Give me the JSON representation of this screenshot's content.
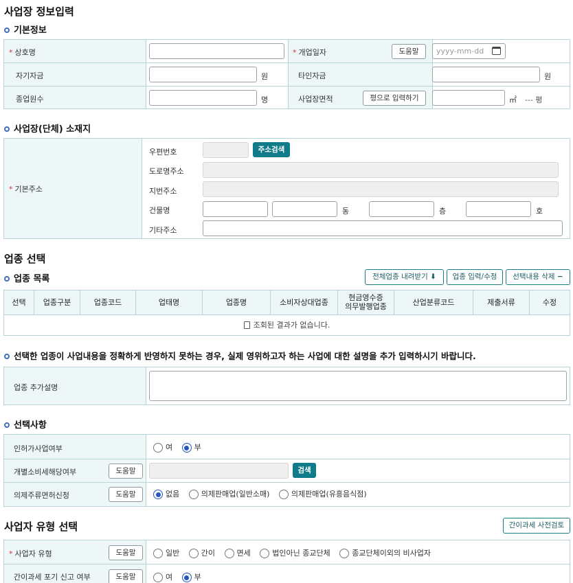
{
  "page_title": "사업장 정보입력",
  "basic": {
    "title": "기본정보",
    "trade_name_label": "상호명",
    "open_date_label": "개업일자",
    "help_label": "도움말",
    "date_placeholder": "yyyy-mm-dd",
    "own_capital_label": "자기자금",
    "won_unit": "원",
    "other_capital_label": "타인자금",
    "employees_label": "종업원수",
    "person_unit": "명",
    "area_label": "사업장면적",
    "pyeong_input_button": "평으로 입력하기",
    "sqm_unit": "㎡",
    "pyeong_readout": "--- 평"
  },
  "location": {
    "title": "사업장(단체) 소재지",
    "base_address_label": "기본주소",
    "zipcode_label": "우편번호",
    "address_search_button": "주소검색",
    "road_address_label": "도로명주소",
    "lot_address_label": "지번주소",
    "building_label": "건물명",
    "dong_unit": "동",
    "floor_unit": "층",
    "ho_unit": "호",
    "other_address_label": "기타주소"
  },
  "industry": {
    "title": "업종 선택",
    "list_title": "업종 목록",
    "download_button": "전체업종 내려받기",
    "edit_button": "업종 입력/수정",
    "delete_button": "선택내용 삭제",
    "columns": [
      "선택",
      "업종구분",
      "업종코드",
      "업태명",
      "업종명",
      "소비자상대업종",
      "현금영수증\n의무발행업종",
      "산업분류코드",
      "제출서류",
      "수정"
    ],
    "empty_message": "조회된 결과가 없습니다.",
    "notice": "선택한 업종이 사업내용을 정확하게 반영하지 못하는 경우, 실제 영위하고자 하는 사업에 대한 설명을 추가 입력하시기 바랍니다.",
    "extra_desc_label": "업종 추가설명"
  },
  "options": {
    "title": "선택사항",
    "license_label": "인허가사업여부",
    "license_options": [
      "여",
      "부"
    ],
    "license_selected": "부",
    "excise_label": "개별소비세해당여부",
    "search_button": "검색",
    "liquor_label": "의제주류면허신청",
    "liquor_options": [
      "없음",
      "의제판매업(일반소매)",
      "의제판매업(유흥음식점)"
    ],
    "liquor_selected": "없음"
  },
  "biz_type": {
    "title": "사업자 유형 선택",
    "precheck_button": "간이과세 사전검토",
    "type_label": "사업자 유형",
    "type_options": [
      "일반",
      "간이",
      "면세",
      "법인아닌 종교단체",
      "종교단체이외의 비사업자"
    ],
    "waiver_label": "간이과세 포기 신고 여부",
    "waiver_options": [
      "여",
      "부"
    ],
    "waiver_selected": "부"
  },
  "colors": {
    "accent_teal": "#107c8a",
    "header_bg": "#eef7f7",
    "border": "#b7d3d8",
    "required": "#d0313f",
    "bullet": "#3d6ebd"
  }
}
